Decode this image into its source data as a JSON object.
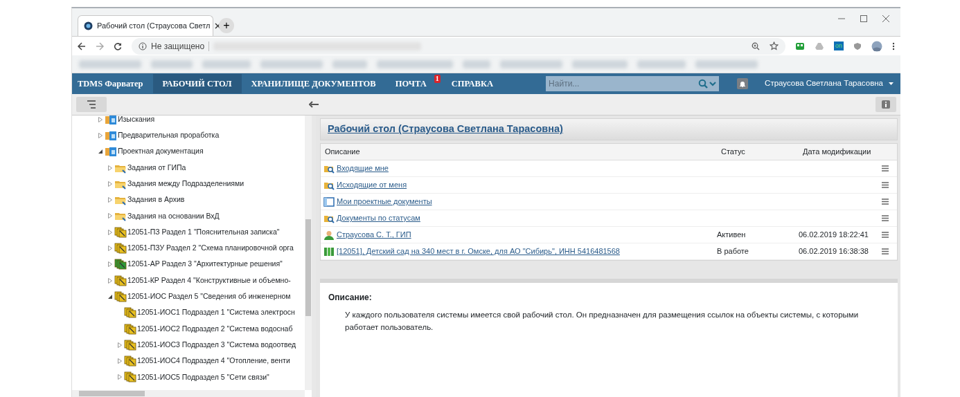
{
  "browser": {
    "tab_title": "Рабочий стол (Страусова Светл",
    "new_tab": "+",
    "security": "Не защищено",
    "extension_label": "on"
  },
  "navbar": {
    "brand": "TDMS Фарватер",
    "items": [
      {
        "label": "РАБОЧИЙ СТОЛ",
        "selected": true
      },
      {
        "label": "ХРАНИЛИЩЕ ДОКУМЕНТОВ",
        "selected": false
      },
      {
        "label": "ПОЧТА",
        "selected": false,
        "badge": "1"
      },
      {
        "label": "СПРАВКА",
        "selected": false
      }
    ],
    "search": {
      "placeholder": "Найти..."
    },
    "user": "Страусова Светлана Тарасовна"
  },
  "tree": [
    {
      "label": "Изыскания",
      "kind": "stage",
      "expanded": false
    },
    {
      "label": "Предварительная проработка",
      "kind": "stage",
      "expanded": false
    },
    {
      "label": "Проектная документация",
      "kind": "stage",
      "expanded": true,
      "children": [
        {
          "label": "Задания от ГИПа",
          "kind": "task-folder",
          "expanded": false
        },
        {
          "label": "Задания между Подразделениями",
          "kind": "task-folder",
          "expanded": false
        },
        {
          "label": "Задания в Архив",
          "kind": "task-folder",
          "expanded": false
        },
        {
          "label": "Задания на основании ВхД",
          "kind": "task-folder",
          "expanded": false
        },
        {
          "label": "12051-ПЗ Раздел 1 \"Пояснительная записка\"",
          "kind": "section",
          "color": "#e8c020",
          "expanded": false
        },
        {
          "label": "12051-ПЗУ Раздел 2 \"Схема планировочной орга",
          "kind": "section",
          "color": "#e8c020",
          "expanded": false
        },
        {
          "label": "12051-АР Раздел 3 \"Архитектурные решения\"",
          "kind": "section",
          "color": "#2e9a3a",
          "expanded": false
        },
        {
          "label": "12051-КР Раздел 4 \"Конструктивные и объемно-",
          "kind": "section",
          "color": "#e8c020",
          "expanded": false
        },
        {
          "label": "12051-ИОС Раздел 5 \"Сведения об инженерном",
          "kind": "section",
          "color": "#e8c020",
          "expanded": true,
          "children": [
            {
              "label": "12051-ИОС1 Подраздел 1 \"Система электросн",
              "kind": "leaf-section",
              "color": "#e8c020"
            },
            {
              "label": "12051-ИОС2 Подраздел 2 \"Система водоснаб",
              "kind": "leaf-section",
              "color": "#e8c020"
            },
            {
              "label": "12051-ИОС3 Подраздел 3 \"Система водоотвед",
              "kind": "section",
              "color": "#e8c020",
              "expanded": false
            },
            {
              "label": "12051-ИОС4 Подраздел 4 \"Отопление, венти",
              "kind": "section",
              "color": "#e8c020",
              "expanded": false
            },
            {
              "label": "12051-ИОС5 Подраздел 5 \"Сети связи\"",
              "kind": "section",
              "color": "#e8c020",
              "expanded": false
            }
          ]
        }
      ]
    }
  ],
  "desk": {
    "title": "Рабочий стол (Страусова Светлана Тарасовна)",
    "columns": [
      "Описание",
      "Статус",
      "Дата модификации"
    ],
    "rows": [
      {
        "kind": "query",
        "name": "Входящие мне"
      },
      {
        "kind": "query",
        "name": "Исходящие от меня"
      },
      {
        "kind": "document",
        "name": "Мои проектные документы"
      },
      {
        "kind": "query",
        "name": "Документы по статусам"
      },
      {
        "kind": "user",
        "name": "Страусова С. Т., ГИП",
        "status": "Активен",
        "date": "06.02.2019 18:22:41"
      },
      {
        "kind": "project",
        "name": "[12051], Детский сад на 340 мест в г. Омске, для АО \"Сибирь\", ИНН 5416481568",
        "status": "В работе",
        "date": "06.02.2019 16:38:38"
      }
    ]
  },
  "description": {
    "heading": "Описание:",
    "text": "У каждого пользователя системы имеется свой рабочий стол. Он предназначен для размещения ссылок на объекты системы, с которыми работает пользователь."
  }
}
